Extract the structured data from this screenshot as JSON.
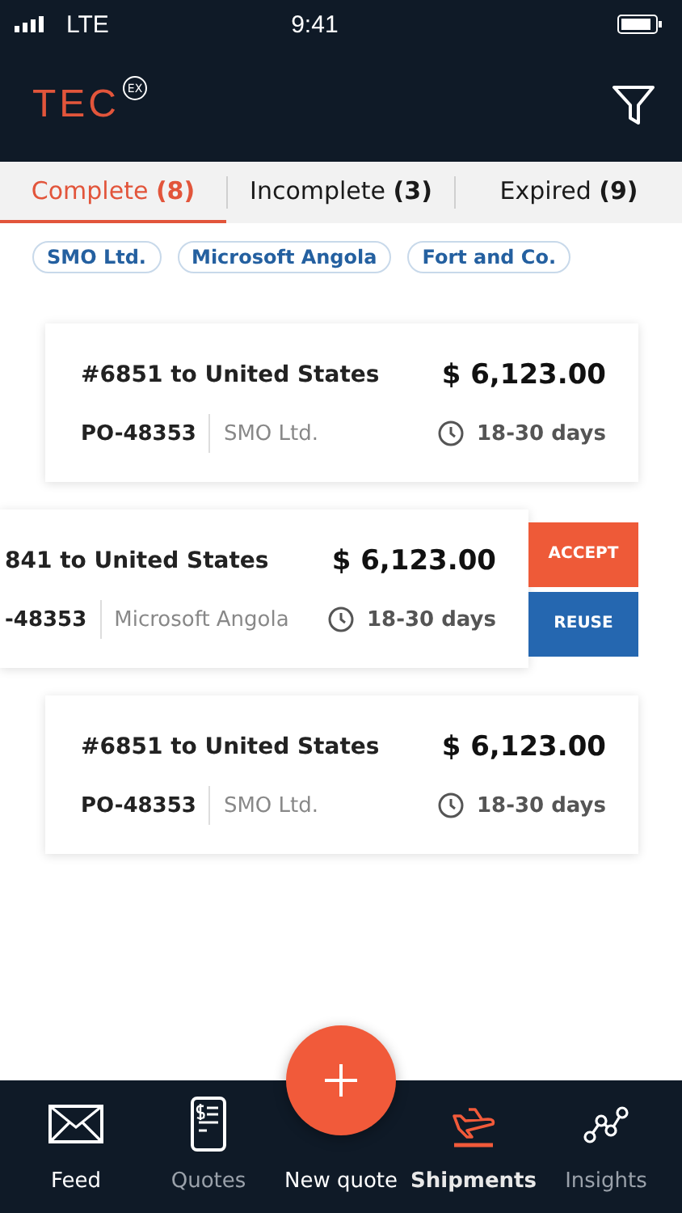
{
  "status_bar": {
    "carrier": "LTE",
    "time": "9:41"
  },
  "header": {
    "logo": "TEC",
    "logo_badge": "EX"
  },
  "tabs": [
    {
      "label": "Complete **(8)**",
      "selected": true
    },
    {
      "label": "Incomplete **(3)**",
      "selected": false
    },
    {
      "label": "Expired **(9)**",
      "selected": false
    }
  ],
  "filters": [
    "SMO Ltd.",
    "Microsoft Angola",
    "Fort and Co."
  ],
  "shipments": [
    {
      "kind": "normal",
      "title": "#6851 to United States",
      "price": "$ 6,123.00",
      "po": "PO-48353",
      "company": "SMO Ltd.",
      "duration": "18-30 days"
    },
    {
      "kind": "swiped",
      "title": "841 to United States",
      "price": "$ 6,123.00",
      "po": "-48353",
      "company": "Microsoft Angola",
      "duration": "18-30 days",
      "actions": [
        "ACCEPT",
        "REUSE"
      ]
    },
    {
      "kind": "normal",
      "title": "#6851 to United States",
      "price": "$ 6,123.00",
      "po": "PO-48353",
      "company": "SMO Ltd.",
      "duration": "18-30 days"
    }
  ],
  "nav": [
    {
      "kind": "feed",
      "label": "Feed",
      "selected": false,
      "dimmed": false
    },
    {
      "kind": "quotes",
      "label": "Quotes",
      "selected": false,
      "dimmed": true
    },
    {
      "kind": "new",
      "label": "New quote",
      "selected": false,
      "dimmed": false
    },
    {
      "kind": "shipments",
      "label": "Shipments",
      "selected": true,
      "dimmed": false
    },
    {
      "kind": "insights",
      "label": "Insights",
      "selected": false,
      "dimmed": true
    }
  ]
}
